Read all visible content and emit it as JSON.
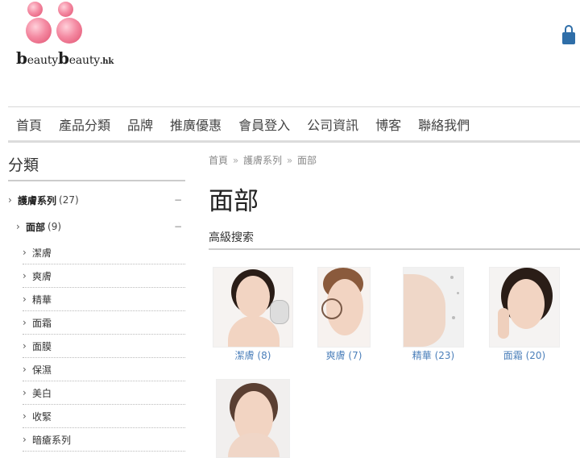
{
  "header": {
    "brand_prefix": "b",
    "brand_mid": "eauty",
    "brand_prefix2": "b",
    "brand_mid2": "eauty",
    "brand_suffix": ".hk",
    "cart_icon": "shopping-bag-icon",
    "colors": {
      "logo_pink": "#e85a78",
      "cart_blue": "#2f6ea8"
    }
  },
  "nav": {
    "items": [
      "首頁",
      "產品分類",
      "品牌",
      "推廣優惠",
      "會員登入",
      "公司資訊",
      "博客",
      "聯絡我們"
    ]
  },
  "sidebar": {
    "title": "分類",
    "top_category": {
      "name": "護膚系列",
      "count": "(27)",
      "toggle": "−"
    },
    "sub_category": {
      "name": "面部",
      "count": "(9)",
      "toggle": "−"
    },
    "items": [
      "潔膚",
      "爽膚",
      "精華",
      "面霜",
      "面膜",
      "保濕",
      "美白",
      "收緊",
      "暗瘡系列"
    ]
  },
  "main": {
    "breadcrumb": [
      "首頁",
      "護膚系列",
      "面部"
    ],
    "breadcrumb_sep": "»",
    "title": "面部",
    "advanced_search": "高級搜索",
    "products": [
      {
        "caption": "潔膚 (8)"
      },
      {
        "caption": "爽膚 (7)"
      },
      {
        "caption": "精華 (23)"
      },
      {
        "caption": "面霜 (20)"
      },
      {
        "caption": ""
      }
    ]
  }
}
